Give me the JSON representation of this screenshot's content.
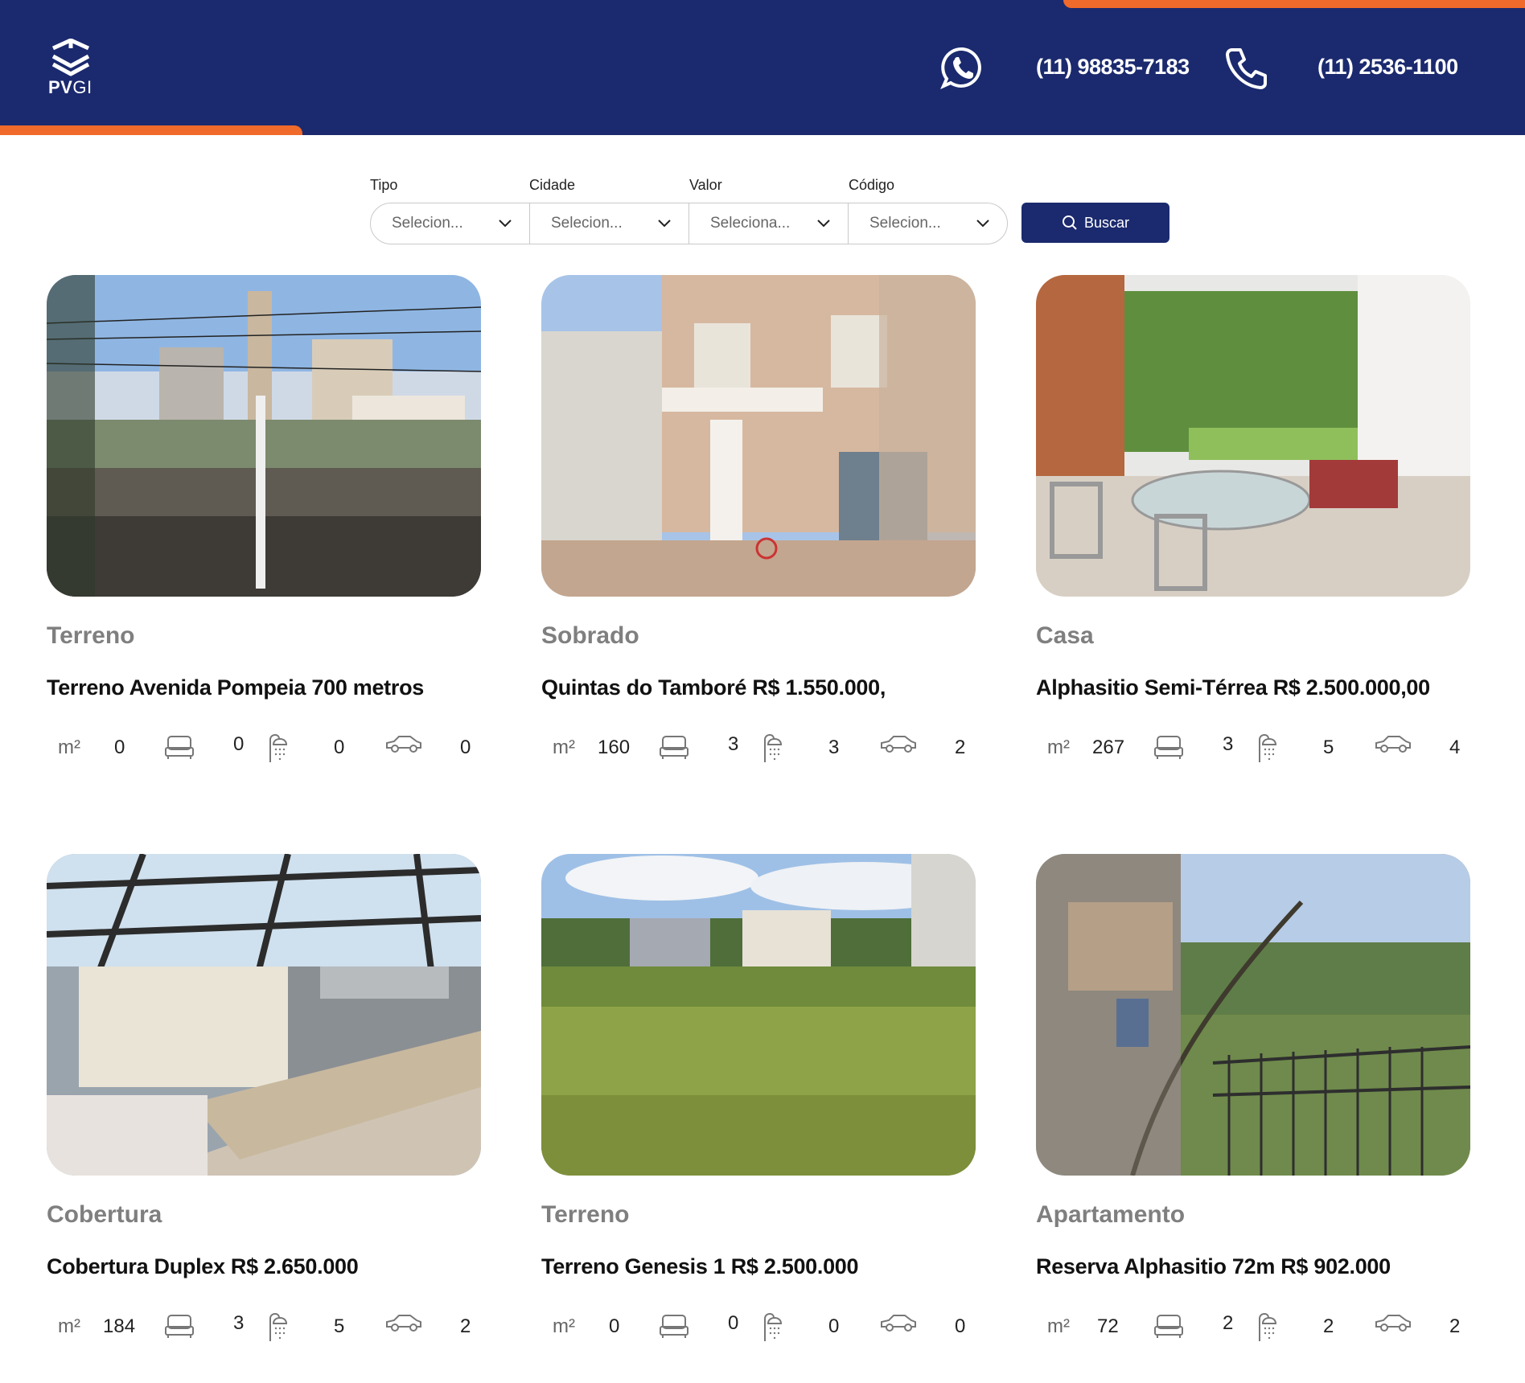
{
  "header": {
    "logo_text_bold": "PV",
    "logo_text_light": "GI",
    "whatsapp_icon": "whatsapp-icon",
    "whatsapp_number": "(11) 98835-7183",
    "phone_icon": "phone-icon",
    "phone_number": "(11) 2536-1100",
    "colors": {
      "navy": "#1b2a6e",
      "orange": "#f06a2b"
    }
  },
  "search": {
    "fields": [
      {
        "label": "Tipo",
        "value": "Selecion..."
      },
      {
        "label": "Cidade",
        "value": "Selecion..."
      },
      {
        "label": "Valor",
        "value": "Seleciona..."
      },
      {
        "label": "Código",
        "value": "Selecion..."
      }
    ],
    "button_label": "Buscar"
  },
  "listings": [
    {
      "type": "Terreno",
      "title": "Terreno Avenida Pompeia 700 metros",
      "area_unit": "m²",
      "area": "0",
      "bedrooms": "0",
      "bathrooms": "0",
      "parking": "0"
    },
    {
      "type": "Sobrado",
      "title": "Quintas do Tamboré R$ 1.550.000,",
      "area_unit": "m²",
      "area": "160",
      "bedrooms": "3",
      "bathrooms": "3",
      "parking": "2"
    },
    {
      "type": "Casa",
      "title": "Alphasitio Semi-Térrea R$ 2.500.000,00",
      "area_unit": "m²",
      "area": "267",
      "bedrooms": "3",
      "bathrooms": "5",
      "parking": "4"
    },
    {
      "type": "Cobertura",
      "title": "Cobertura Duplex R$ 2.650.000",
      "area_unit": "m²",
      "area": "184",
      "bedrooms": "3",
      "bathrooms": "5",
      "parking": "2"
    },
    {
      "type": "Terreno",
      "title": "Terreno Genesis 1 R$ 2.500.000",
      "area_unit": "m²",
      "area": "0",
      "bedrooms": "0",
      "bathrooms": "0",
      "parking": "0"
    },
    {
      "type": "Apartamento",
      "title": "Reserva Alphasitio 72m R$ 902.000",
      "area_unit": "m²",
      "area": "72",
      "bedrooms": "2",
      "bathrooms": "2",
      "parking": "2"
    }
  ]
}
